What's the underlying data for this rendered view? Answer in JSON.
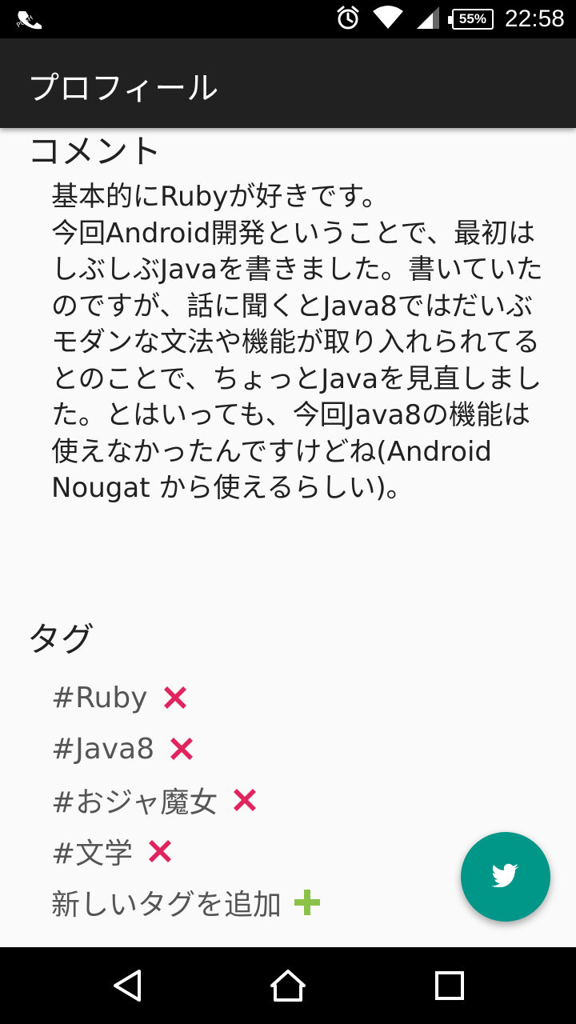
{
  "status_bar": {
    "time": "22:58",
    "battery_percent": "55%",
    "icons": [
      "push-notification-icon",
      "alarm-icon",
      "wifi-icon",
      "cell-signal-icon",
      "battery-icon"
    ]
  },
  "app_bar": {
    "title": "プロフィール"
  },
  "comment_section": {
    "heading": "コメント",
    "body": "基本的にRubyが好きです。\n今回Android開発ということで、最初はしぶしぶJavaを書きました。書いていたのですが、話に聞くとJava8ではだいぶモダンな文法や機能が取り入れられてるとのことで、ちょっとJavaを見直しました。とはいっても、今回Java8の機能は使えなかったんですけどね(Android Nougat から使えるらしい)。"
  },
  "tags_section": {
    "heading": "タグ",
    "tags": [
      "#Ruby",
      "#Java8",
      "#おジャ魔女",
      "#文学"
    ],
    "add_label": "新しいタグを追加"
  },
  "fab": {
    "icon": "twitter-icon",
    "color": "#009688"
  },
  "colors": {
    "remove_icon": "#e0245e",
    "add_icon": "#8bc34a",
    "app_bar": "#212121"
  },
  "nav_bar": {
    "buttons": [
      "back-icon",
      "home-icon",
      "recents-icon"
    ]
  }
}
